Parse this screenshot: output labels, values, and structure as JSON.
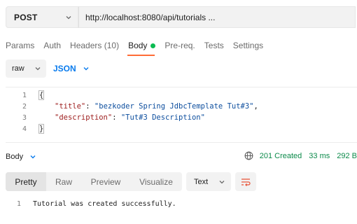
{
  "request": {
    "method": "POST",
    "url": "http://localhost:8080/api/tutorials ..."
  },
  "request_tabs": [
    {
      "label": "Params",
      "active": false
    },
    {
      "label": "Auth",
      "active": false
    },
    {
      "label": "Headers (10)",
      "active": false
    },
    {
      "label": "Body",
      "active": true
    },
    {
      "label": "Pre-req.",
      "active": false
    },
    {
      "label": "Tests",
      "active": false
    },
    {
      "label": "Settings",
      "active": false
    }
  ],
  "body_mode": {
    "type": "raw",
    "language": "JSON"
  },
  "editor": {
    "lines": [
      {
        "n": "1",
        "text": "{"
      },
      {
        "n": "2",
        "key": "\"title\"",
        "sep": ": ",
        "value": "\"bezkoder Spring JdbcTemplate Tut#3\"",
        "end": ","
      },
      {
        "n": "3",
        "key": "\"description\"",
        "sep": ": ",
        "value": "\"Tut#3 Description\"",
        "end": ""
      },
      {
        "n": "4",
        "text": "}"
      }
    ]
  },
  "response": {
    "section_label": "Body",
    "status": "201 Created",
    "time": "33 ms",
    "size": "292 B",
    "view_tabs": [
      "Pretty",
      "Raw",
      "Preview",
      "Visualize"
    ],
    "active_view": "Pretty",
    "format": "Text",
    "lines": [
      {
        "n": "1",
        "text": "Tutorial was created successfully."
      }
    ]
  },
  "colors": {
    "active_dot": "#0cbb52",
    "tab_underline": "#ff6c37",
    "json_label": "#097bed",
    "status_green": "#0b8a4a",
    "wrap_icon": "#e8573c"
  },
  "icons": {
    "method_dropdown": "chevron-down-icon",
    "raw_dropdown": "chevron-down-icon",
    "json_dropdown": "chevron-down-icon",
    "response_body_dropdown": "chevron-down-icon",
    "network": "globe-icon",
    "text_dropdown": "chevron-down-icon",
    "wrap": "wrap-lines-icon"
  }
}
